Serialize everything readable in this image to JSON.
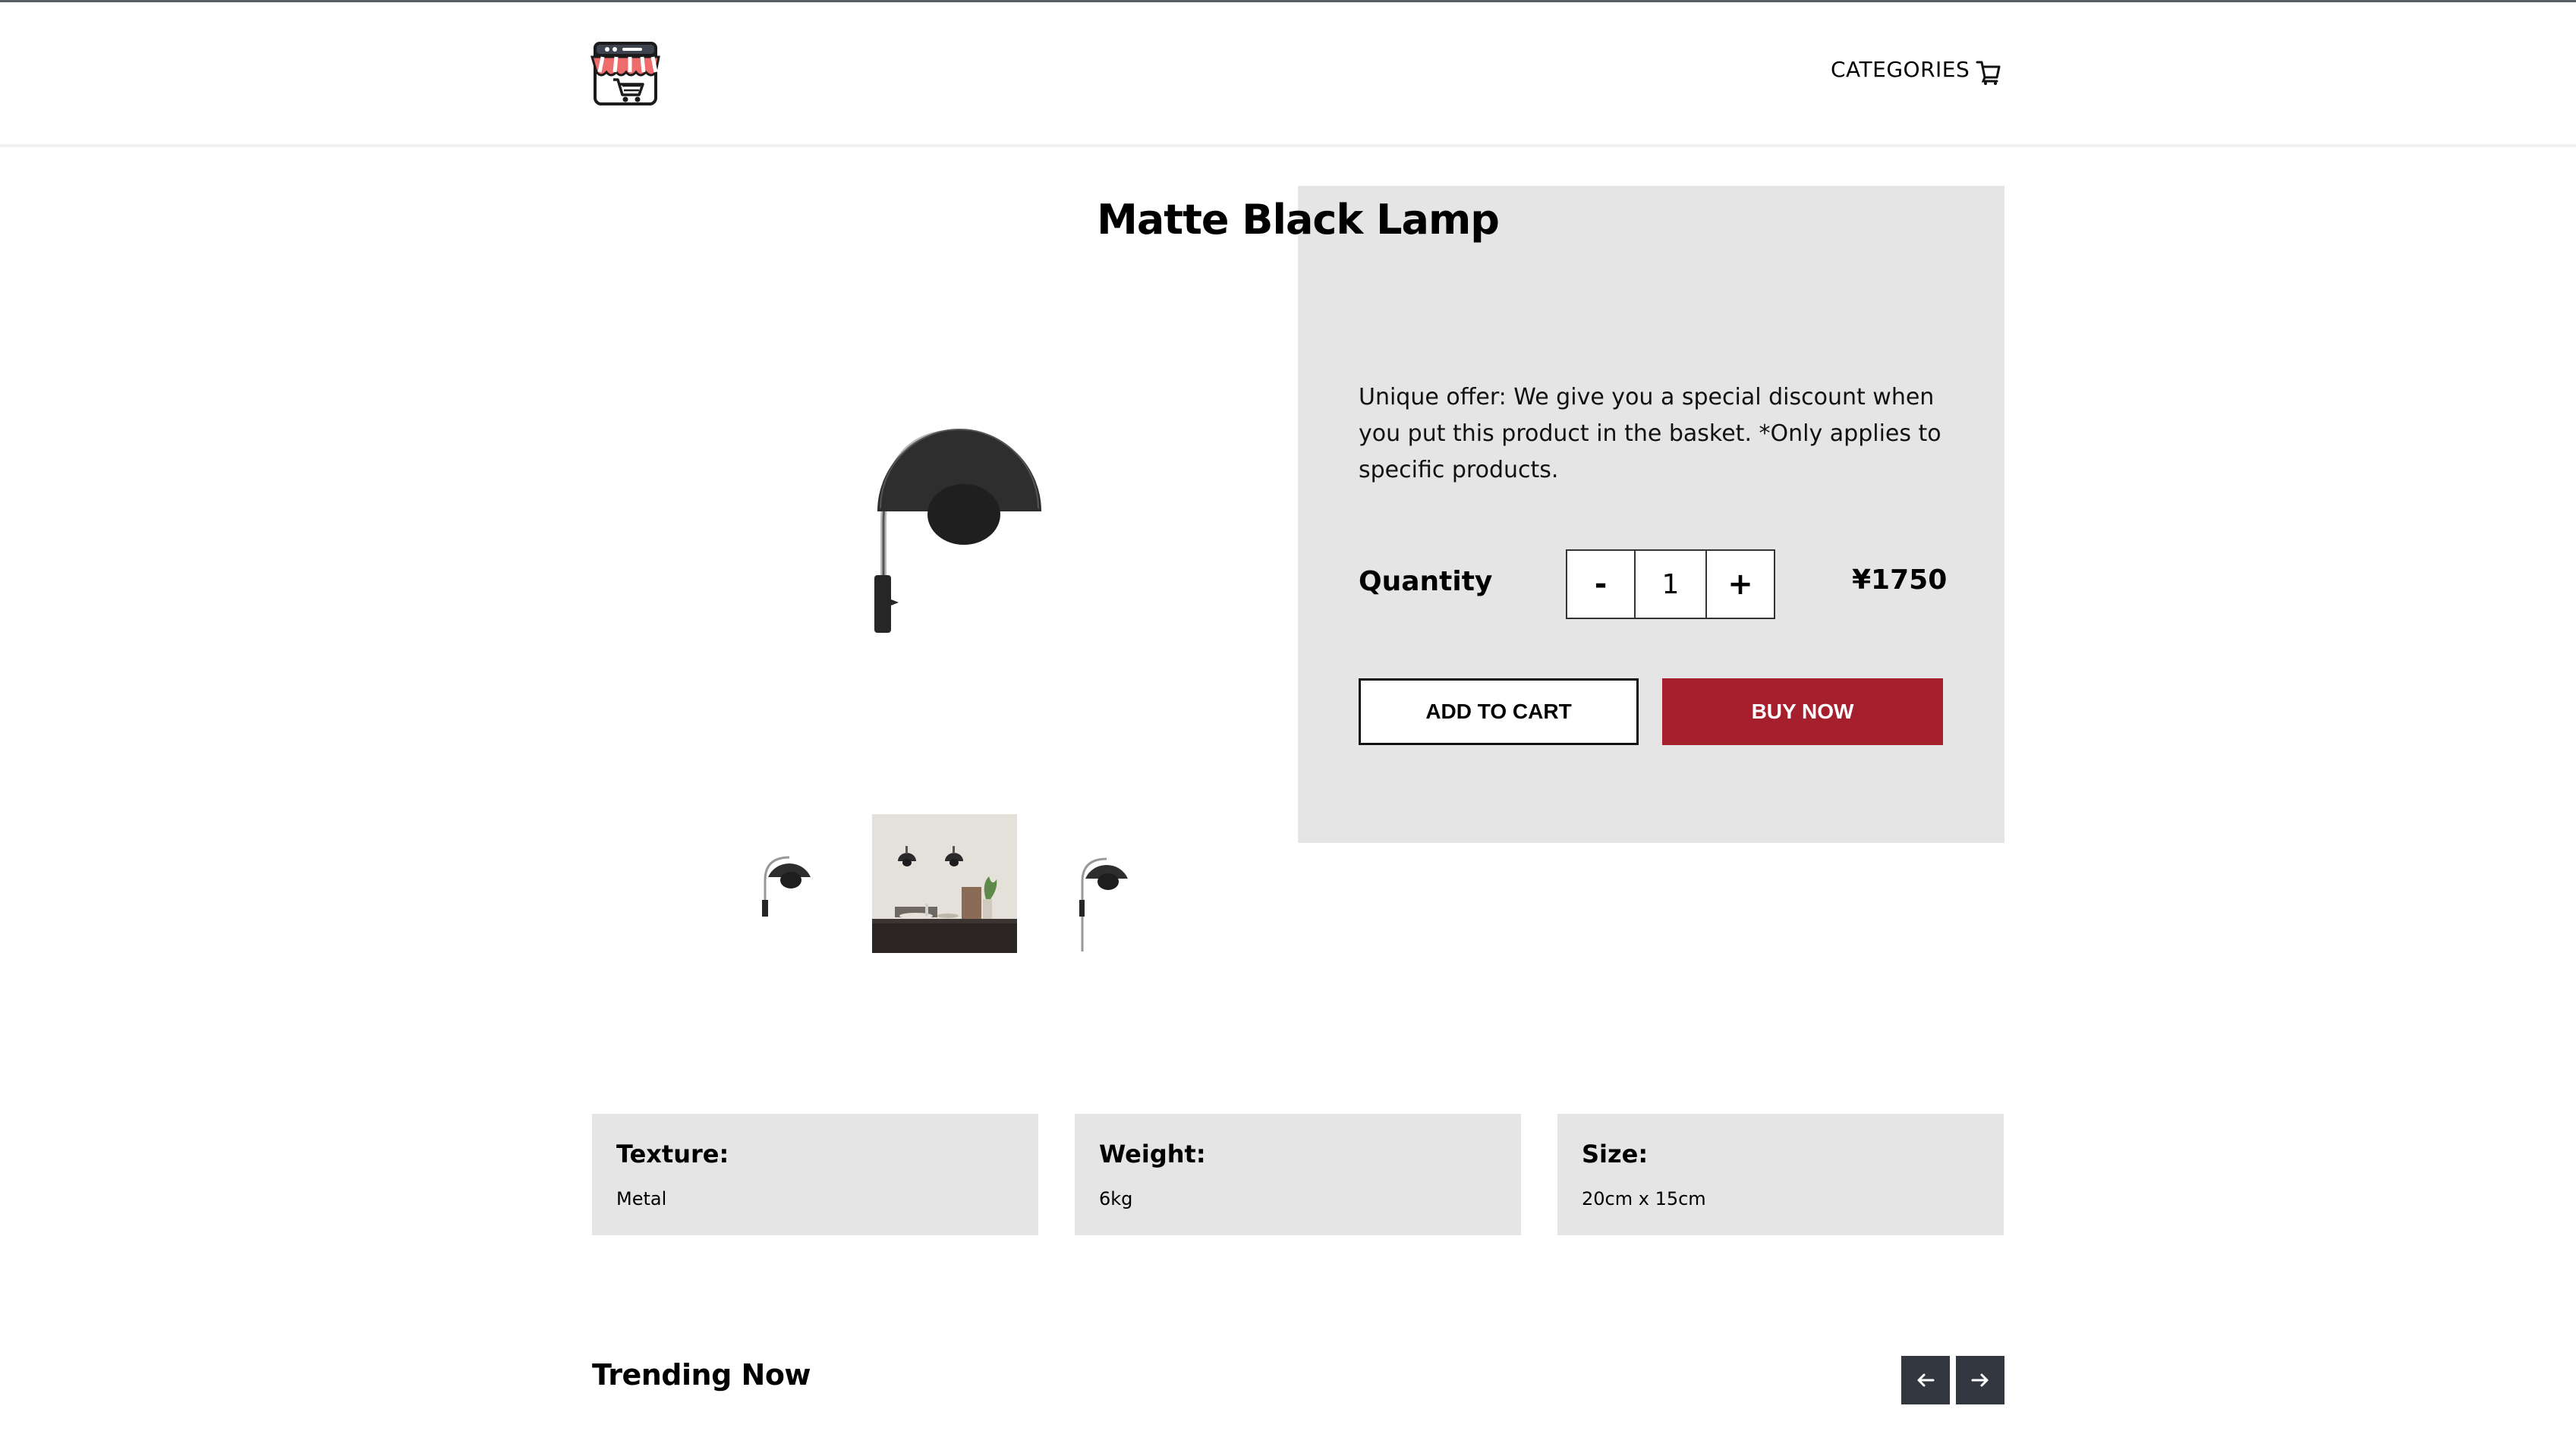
{
  "colors": {
    "accent": "#a51f2d",
    "panel": "#e5e5e5",
    "arrow_bg": "#333840"
  },
  "header": {
    "logo_icon": "shop-cart-logo-icon",
    "categories_label": "CATEGORIES",
    "cart_icon": "cart-icon"
  },
  "product": {
    "title": "Matte Black Lamp",
    "offer_text": "Unique offer: We give you a special discount when you put this product in the basket. *Only applies to specific products.",
    "quantity_label": "Quantity",
    "quantity_value": "1",
    "minus_label": "-",
    "plus_label": "+",
    "price": "¥1750",
    "add_to_cart_label": "ADD TO CART",
    "buy_now_label": "BUY NOW"
  },
  "specs": [
    {
      "label": "Texture:",
      "value": "Metal"
    },
    {
      "label": "Weight:",
      "value": "6kg"
    },
    {
      "label": "Size:",
      "value": "20cm x 15cm"
    }
  ],
  "trending": {
    "title": "Trending Now",
    "prev_icon": "arrow-left-icon",
    "next_icon": "arrow-right-icon"
  }
}
